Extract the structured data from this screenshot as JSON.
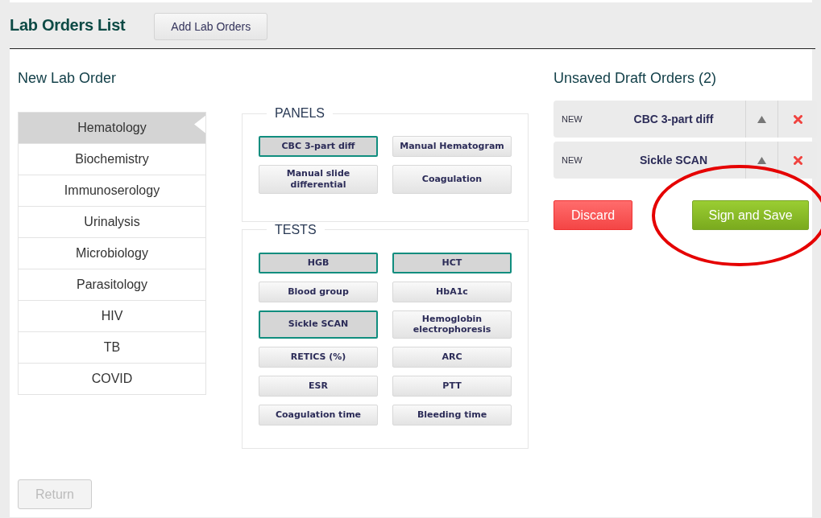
{
  "header": {
    "title": "Lab Orders List",
    "add_button": "Add Lab Orders"
  },
  "new_order": {
    "title": "New Lab Order",
    "categories": [
      {
        "label": "Hematology",
        "selected": true
      },
      {
        "label": "Biochemistry",
        "selected": false
      },
      {
        "label": "Immunoserology",
        "selected": false
      },
      {
        "label": "Urinalysis",
        "selected": false
      },
      {
        "label": "Microbiology",
        "selected": false
      },
      {
        "label": "Parasitology",
        "selected": false
      },
      {
        "label": "HIV",
        "selected": false
      },
      {
        "label": "TB",
        "selected": false
      },
      {
        "label": "COVID",
        "selected": false
      }
    ],
    "panels": {
      "legend": "PANELS",
      "items": [
        {
          "label": "CBC 3-part diff",
          "selected": true
        },
        {
          "label": "Manual Hematogram",
          "selected": false
        },
        {
          "label": "Manual slide differential",
          "selected": false
        },
        {
          "label": "Coagulation",
          "selected": false
        }
      ]
    },
    "tests": {
      "legend": "TESTS",
      "items": [
        {
          "label": "HGB",
          "selected": true
        },
        {
          "label": "HCT",
          "selected": true
        },
        {
          "label": "Blood group",
          "selected": false
        },
        {
          "label": "HbA1c",
          "selected": false
        },
        {
          "label": "Sickle SCAN",
          "selected": true
        },
        {
          "label": "Hemoglobin electrophoresis",
          "selected": false
        },
        {
          "label": "RETICS (%)",
          "selected": false
        },
        {
          "label": "ARC",
          "selected": false
        },
        {
          "label": "ESR",
          "selected": false
        },
        {
          "label": "PTT",
          "selected": false
        },
        {
          "label": "Coagulation time",
          "selected": false
        },
        {
          "label": "Bleeding time",
          "selected": false
        }
      ]
    },
    "return_button": {
      "label": "Return",
      "disabled": true
    }
  },
  "drafts": {
    "title": "Unsaved Draft Orders (2)",
    "items": [
      {
        "status": "NEW",
        "name": "CBC 3-part diff"
      },
      {
        "status": "NEW",
        "name": "Sickle SCAN"
      }
    ],
    "discard_button": "Discard",
    "save_button": "Sign and Save"
  }
}
